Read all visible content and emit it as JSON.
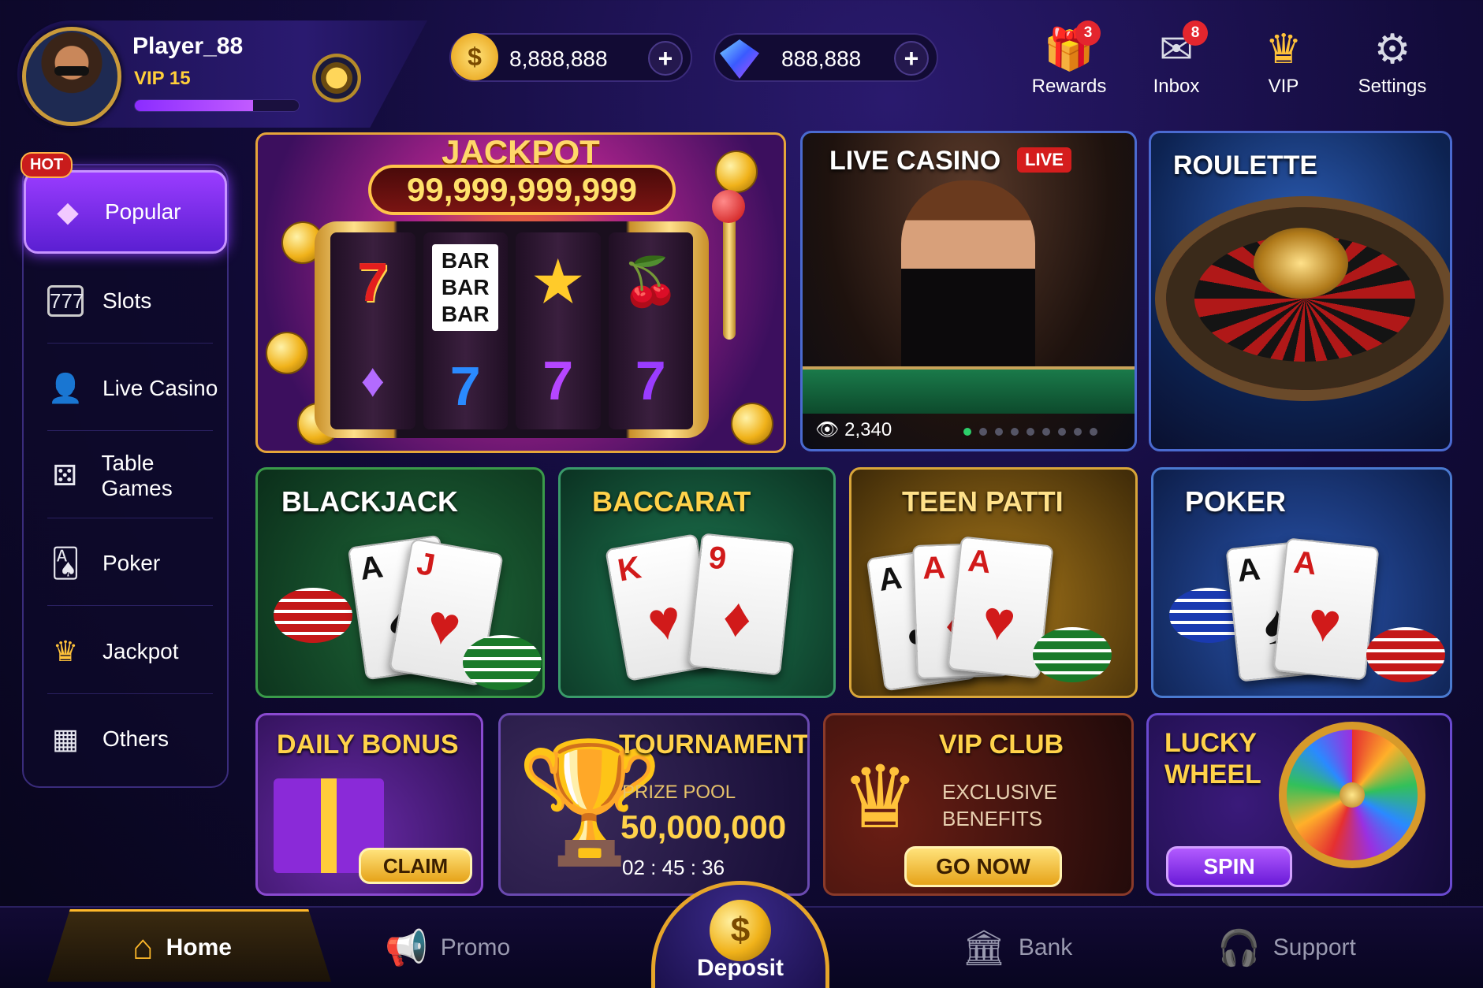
{
  "player": {
    "name": "Player_88",
    "vip": "VIP 15",
    "xp_fraction": 0.72
  },
  "currency": {
    "gold": "8,888,888",
    "gems": "888,888",
    "add": "+",
    "coin_symbol": "$"
  },
  "topnav": [
    {
      "label": "Rewards",
      "icon": "gift-icon",
      "badge": "3"
    },
    {
      "label": "Inbox",
      "icon": "mail-icon",
      "badge": "8"
    },
    {
      "label": "VIP",
      "icon": "crown-icon",
      "badge": ""
    },
    {
      "label": "Settings",
      "icon": "gear-icon",
      "badge": ""
    }
  ],
  "sidebar": {
    "hot_badge": "HOT",
    "items": [
      {
        "label": "Popular",
        "icon": "diamond-icon",
        "active": true
      },
      {
        "label": "Slots",
        "icon": "slot-machine-icon"
      },
      {
        "label": "Live Casino",
        "icon": "dealer-icon"
      },
      {
        "label": "Table Games",
        "icon": "dice-icon"
      },
      {
        "label": "Poker",
        "icon": "card-icon"
      },
      {
        "label": "Jackpot",
        "icon": "crown-icon"
      },
      {
        "label": "Others",
        "icon": "grid-icon"
      }
    ]
  },
  "jackpot": {
    "title": "JACKPOT",
    "amount": "99,999,999,999",
    "reels": [
      [
        "7",
        "♦"
      ],
      [
        "BAR BAR BAR",
        "7"
      ],
      [
        "★",
        "7"
      ],
      [
        "🍒",
        "7"
      ]
    ]
  },
  "live_casino": {
    "title": "LIVE CASINO",
    "badge": "LIVE",
    "viewers": "2,340"
  },
  "roulette": {
    "title": "ROULETTE"
  },
  "games": {
    "blackjack": {
      "title": "BLACKJACK",
      "cards": [
        "A",
        "J"
      ]
    },
    "baccarat": {
      "title": "BACCARAT",
      "cards": [
        "K",
        "9"
      ]
    },
    "teenpatti": {
      "title": "TEEN PATTI",
      "cards": [
        "A",
        "A",
        "A"
      ]
    },
    "poker": {
      "title": "POKER",
      "cards": [
        "A",
        "A"
      ]
    }
  },
  "promos": {
    "daily": {
      "title": "DAILY BONUS",
      "button": "CLAIM"
    },
    "tournament": {
      "title": "TOURNAMENT",
      "subtitle": "PRIZE POOL",
      "prize": "50,000,000",
      "timer": "02 : 45 : 36"
    },
    "vip": {
      "title": "VIP CLUB",
      "line1": "EXCLUSIVE",
      "line2": "BENEFITS",
      "button": "GO NOW"
    },
    "lucky": {
      "title1": "LUCKY",
      "title2": "WHEEL",
      "button": "SPIN"
    }
  },
  "bottomnav": [
    {
      "label": "Home",
      "icon": "home-icon",
      "active": true
    },
    {
      "label": "Promo",
      "icon": "megaphone-icon"
    },
    {
      "label": "Deposit",
      "icon": "coin-icon"
    },
    {
      "label": "Bank",
      "icon": "bank-icon"
    },
    {
      "label": "Support",
      "icon": "headset-icon"
    }
  ],
  "colors": {
    "accent": "#9a3cff",
    "gold": "#ffd24a",
    "live_red": "#d51d1d",
    "online_dot": "#2ccf6a"
  }
}
